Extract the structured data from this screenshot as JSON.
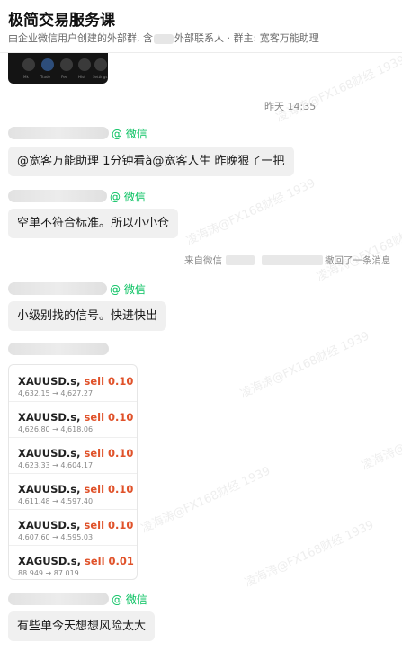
{
  "header": {
    "title": "极简交易服务课",
    "subtitle_prefix": "由企业微信用户创建的外部群, 含",
    "subtitle_suffix": "外部联系人 · 群主: 宽客万能助理"
  },
  "thumbnail": {
    "labels": [
      "Mk",
      "Trade",
      "Fee",
      "Hist",
      "Settings"
    ]
  },
  "timestamp": "昨天 14:35",
  "messages": [
    {
      "source": "@ 微信",
      "text": "@宽客万能助理 1分钟看à@宽客人生 昨晚狠了一把"
    },
    {
      "source": "@ 微信",
      "text": "空单不符合标准。所以小小仓"
    },
    {
      "source": "@ 微信",
      "text": "小级别找的信号。快进快出"
    },
    {
      "source": "@ 微信",
      "text": "有些单今天想想风险太大"
    }
  ],
  "recall_notice": {
    "prefix": "来自微信",
    "suffix": "撤回了一条消息"
  },
  "trades": [
    {
      "symbol": "XAUUSD.s,",
      "side": "sell 0.10",
      "prices": "4,632.15 → 4,627.27"
    },
    {
      "symbol": "XAUUSD.s,",
      "side": "sell 0.10",
      "prices": "4,626.80 → 4,618.06"
    },
    {
      "symbol": "XAUUSD.s,",
      "side": "sell 0.10",
      "prices": "4,623.33 → 4,604.17"
    },
    {
      "symbol": "XAUUSD.s,",
      "side": "sell 0.10",
      "prices": "4,611.48 → 4,597.40"
    },
    {
      "symbol": "XAUUSD.s,",
      "side": "sell 0.10",
      "prices": "4,607.60 → 4,595.03"
    },
    {
      "symbol": "XAGUSD.s,",
      "side": "sell 0.01",
      "prices": "88.949 → 87.019"
    }
  ],
  "watermark": "凌海涛@FX168财经 1939",
  "colors": {
    "wechat_green": "#07c160",
    "sell_red": "#e0522a",
    "bubble_bg": "#f0f0f0"
  }
}
